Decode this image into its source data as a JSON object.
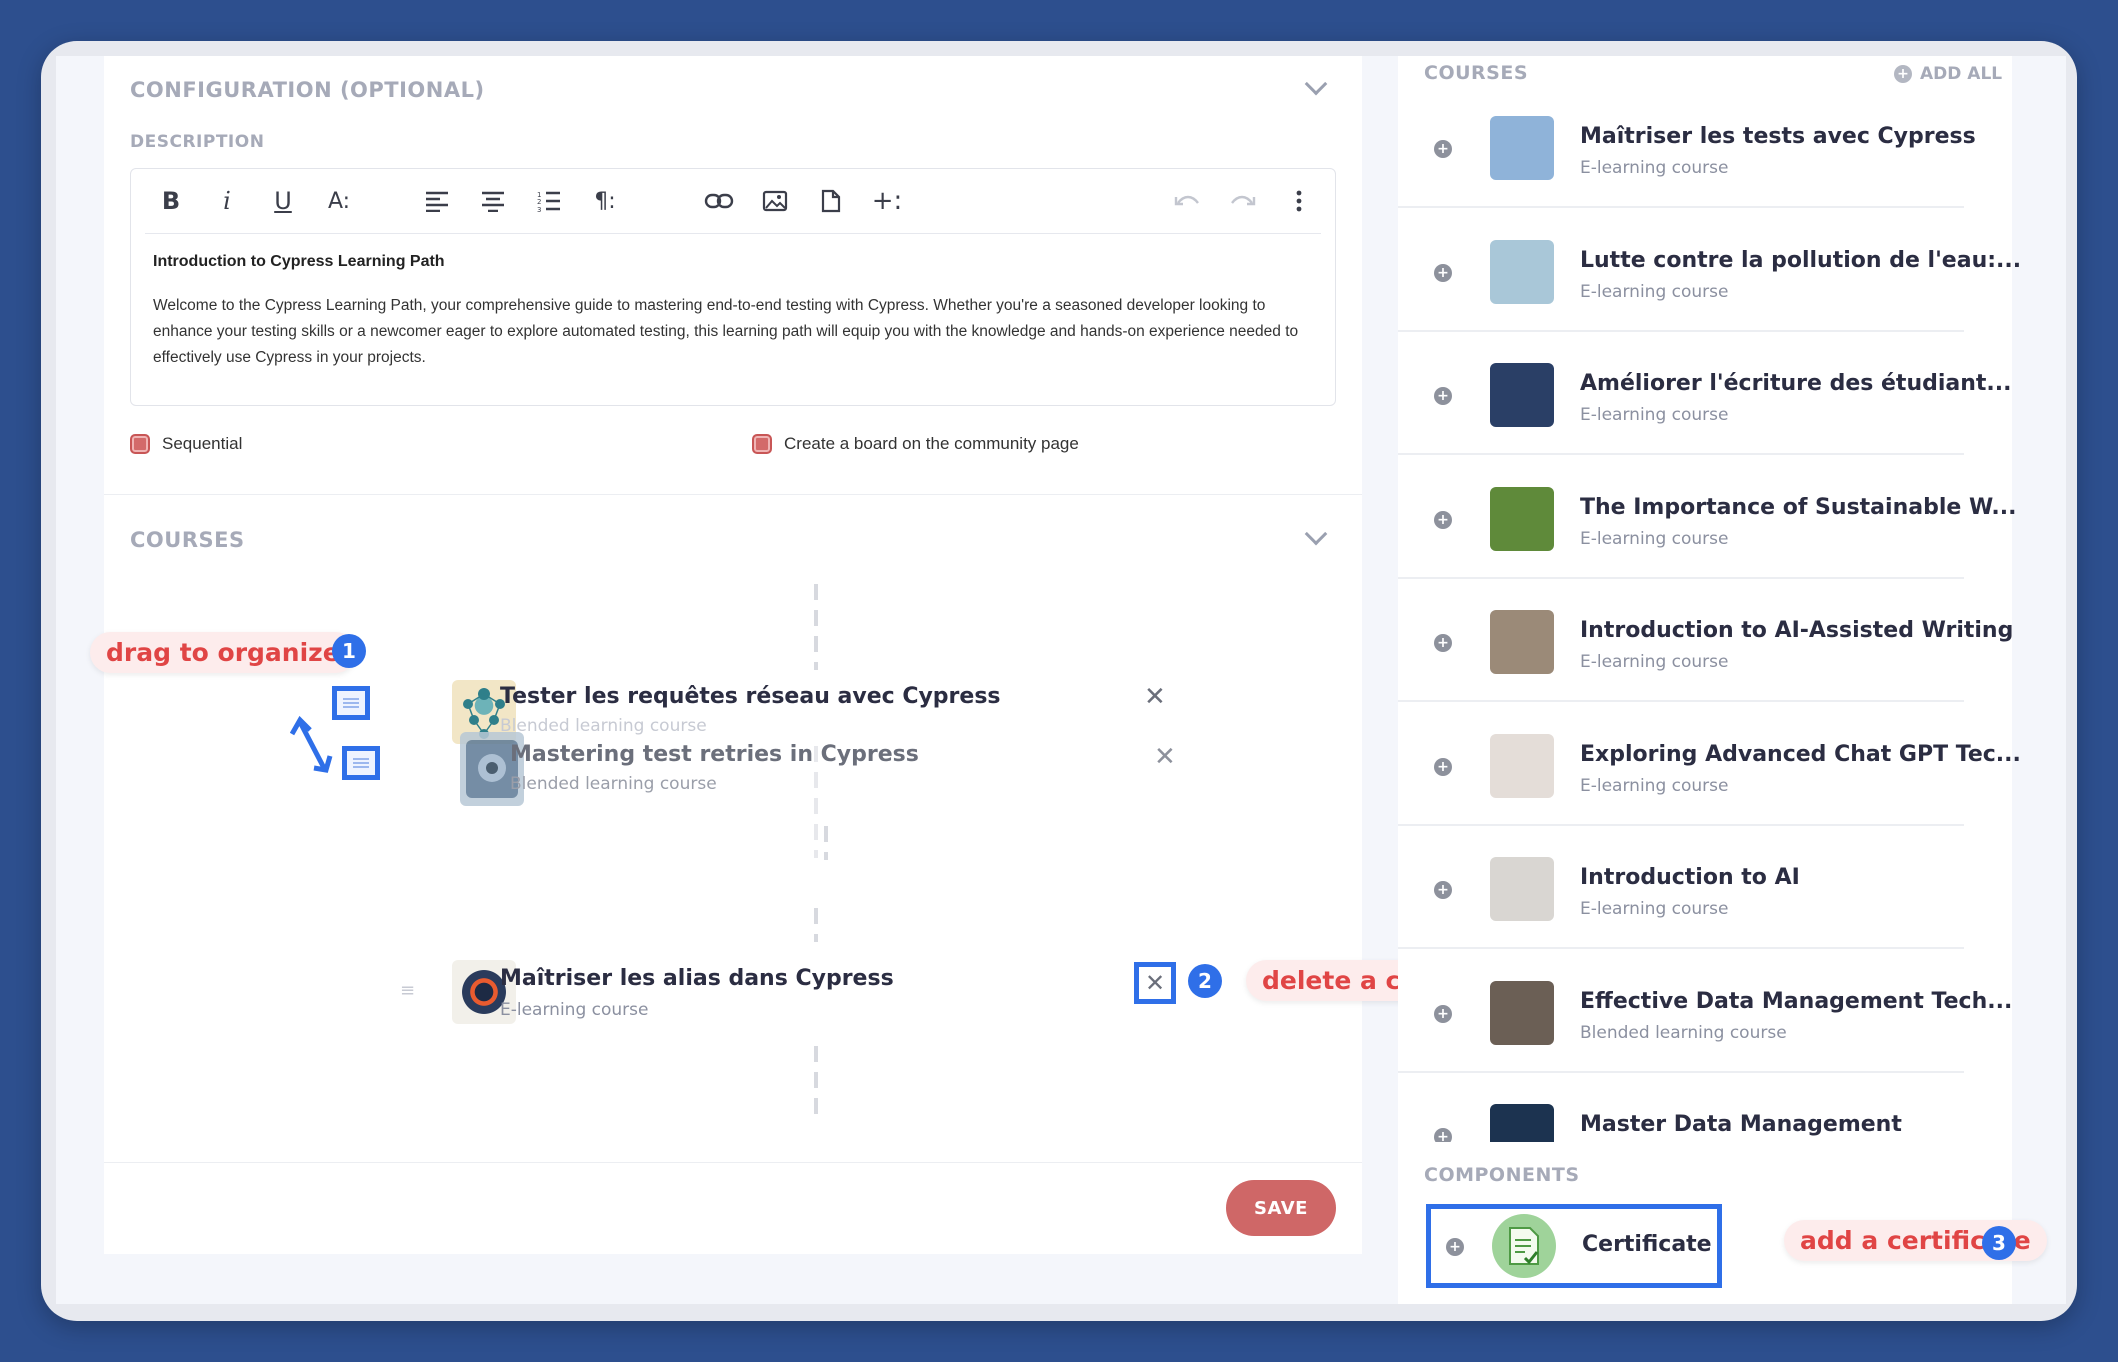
{
  "config": {
    "title": "CONFIGURATION (OPTIONAL)",
    "description_label": "DESCRIPTION",
    "editor_title": "Introduction to Cypress Learning Path",
    "editor_body": "Welcome to the Cypress Learning Path, your comprehensive guide to mastering end-to-end testing with Cypress. Whether you're a seasoned developer looking to enhance your testing skills or a newcomer eager to explore automated testing, this learning path will equip you with the knowledge and hands-on experience needed to effectively use Cypress in your projects.",
    "toolbar": [
      "B",
      "i",
      "U",
      "A:",
      "align-left-icon",
      "align-center-icon",
      "ordered-list-icon",
      "¶:",
      "link-icon",
      "image-icon",
      "file-icon",
      "+:",
      "undo-icon",
      "redo-icon",
      "more-icon"
    ],
    "sequential_label": "Sequential",
    "board_label": "Create a board on the community page"
  },
  "courses_section": {
    "title": "COURSES",
    "items": [
      {
        "title": "Tester les requêtes réseau avec Cypress",
        "subtitle": "Blended learning course"
      },
      {
        "title": "Mastering test retries in Cypress",
        "subtitle": "Blended learning course"
      },
      {
        "title": "Maîtriser les alias dans Cypress",
        "subtitle": "E-learning course"
      }
    ]
  },
  "annotations": {
    "drag": {
      "label": "drag to organize",
      "num": "1"
    },
    "delete": {
      "label": "delete a choice",
      "num": "2"
    },
    "certificate": {
      "label": "add a certificate",
      "num": "3"
    }
  },
  "save_label": "SAVE",
  "sidebar": {
    "courses_title": "COURSES",
    "add_all": "ADD ALL",
    "items": [
      {
        "title": "Maîtriser les tests avec Cypress",
        "subtitle": "E-learning course",
        "color": "#8fb3d9"
      },
      {
        "title": "Lutte contre la pollution de l'eau:...",
        "subtitle": "E-learning course",
        "color": "#a9c7d8"
      },
      {
        "title": "Améliorer l'écriture des étudiant...",
        "subtitle": "E-learning course",
        "color": "#2a3f66"
      },
      {
        "title": "The Importance of Sustainable W...",
        "subtitle": "E-learning course",
        "color": "#5f8a3a"
      },
      {
        "title": "Introduction to AI-Assisted Writing",
        "subtitle": "E-learning course",
        "color": "#9b8a78"
      },
      {
        "title": "Exploring Advanced Chat GPT Tec...",
        "subtitle": "E-learning course",
        "color": "#e4ddd8"
      },
      {
        "title": "Introduction to AI",
        "subtitle": "E-learning course",
        "color": "#d9d6d2"
      },
      {
        "title": "Effective Data Management Tech...",
        "subtitle": "Blended learning course",
        "color": "#6b5f55"
      },
      {
        "title": "Master Data Management",
        "subtitle": "",
        "color": "#1c3350"
      }
    ],
    "components_title": "COMPONENTS",
    "certificate_label": "Certificate"
  }
}
